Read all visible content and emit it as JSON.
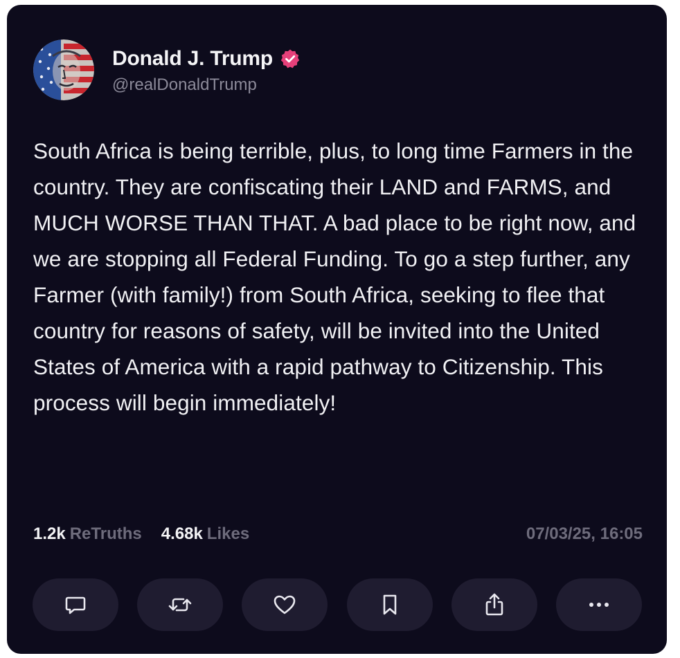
{
  "author": {
    "display_name": "Donald J. Trump",
    "handle": "@realDonaldTrump",
    "verified": true,
    "verified_color": "#e6407a",
    "avatar_icon": "american-flag-portrait-avatar"
  },
  "post": {
    "text": "South Africa is being terrible, plus, to long time Farmers in the country. They are confiscating their LAND and FARMS, and MUCH WORSE THAN THAT. A bad place to be right now, and we are stopping all Federal Funding. To go a step further, any Farmer (with family!) from South Africa, seeking to flee that country for reasons of safety, will be invited into the United States of America with a rapid pathway to Citizenship. This process will begin immediately!"
  },
  "stats": {
    "retruths_count": "1.2k",
    "retruths_label": "ReTruths",
    "likes_count": "4.68k",
    "likes_label": "Likes",
    "timestamp": "07/03/25, 16:05"
  },
  "actions": [
    {
      "icon": "reply-icon"
    },
    {
      "icon": "retruth-icon"
    },
    {
      "icon": "heart-icon"
    },
    {
      "icon": "bookmark-icon"
    },
    {
      "icon": "share-icon"
    },
    {
      "icon": "more-icon"
    }
  ],
  "colors": {
    "card_background": "#0d0b1c",
    "button_background": "#1f1c30",
    "muted_text": "#6e6c7c",
    "handle_text": "#8c8a99"
  }
}
